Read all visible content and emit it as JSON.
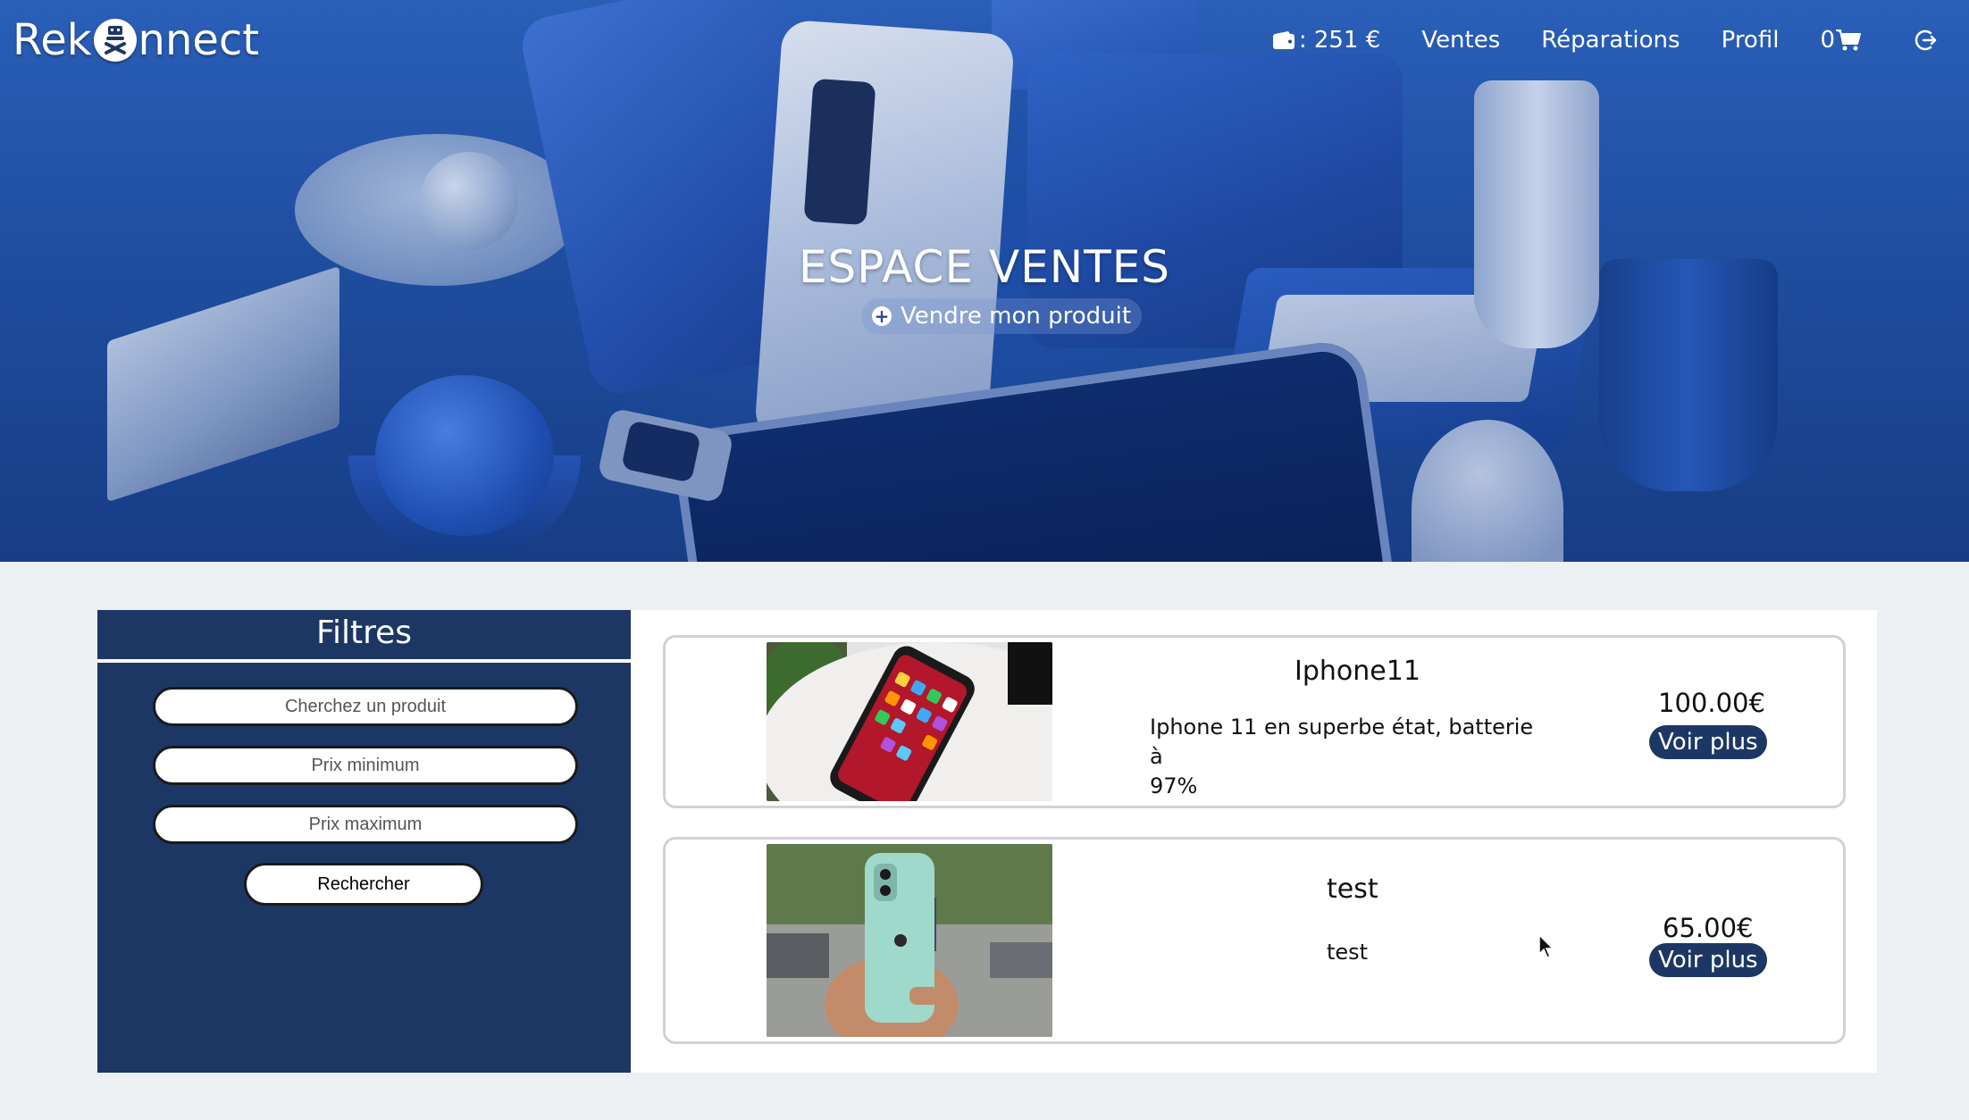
{
  "brand": {
    "name_left": "Rek",
    "name_right": "nnect",
    "logo_icon": "robot-badge-icon"
  },
  "nav": {
    "wallet_icon": "wallet-icon",
    "wallet_text": ": 251 €",
    "sales": "Ventes",
    "repairs": "Réparations",
    "profile": "Profil",
    "cart_count": "0",
    "cart_icon": "cart-icon",
    "logout_icon": "logout-icon"
  },
  "hero": {
    "title": "ESPACE VENTES",
    "sell_button": "Vendre mon produit",
    "sell_icon": "plus-circle-icon"
  },
  "filters": {
    "title": "Filtres",
    "search_placeholder": "Cherchez un produit",
    "min_price_placeholder": "Prix minimum",
    "max_price_placeholder": "Prix maximum",
    "search_button": "Rechercher"
  },
  "products": [
    {
      "title": "Iphone11",
      "description_line1": "Iphone 11 en superbe état, batterie à",
      "description_line2": "97%",
      "price": "100.00€",
      "more": "Voir plus",
      "image": "red-iphone-photo"
    },
    {
      "title": "test",
      "description_line1": "test",
      "description_line2": "",
      "price": "65.00€",
      "more": "Voir plus",
      "image": "mint-iphone-photo"
    }
  ],
  "colors": {
    "navy": "#1d3764",
    "hero_blue": "#1e4c9d",
    "page_bg": "#ecf0f3"
  }
}
